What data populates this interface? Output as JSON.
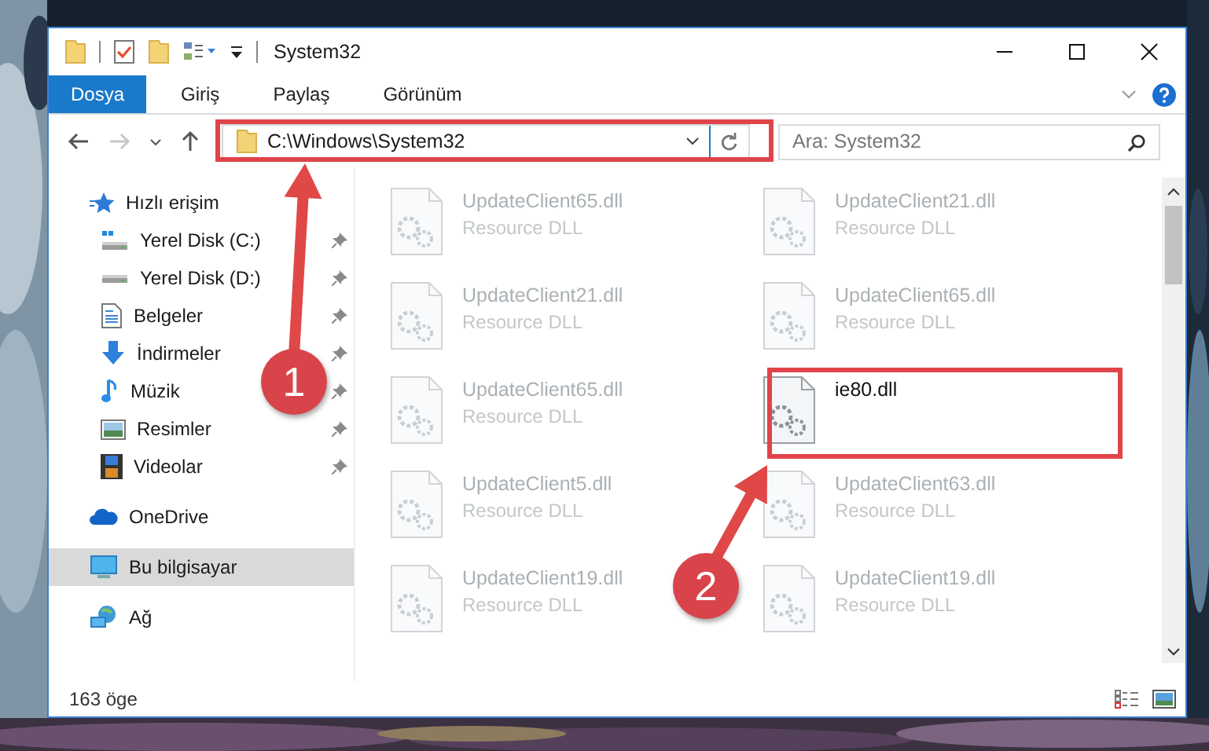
{
  "window": {
    "title": "System32"
  },
  "ribbon_tabs": [
    {
      "label": "Dosya",
      "selected": true
    },
    {
      "label": "Giriş",
      "selected": false
    },
    {
      "label": "Paylaş",
      "selected": false
    },
    {
      "label": "Görünüm",
      "selected": false
    }
  ],
  "address_bar": {
    "path": "C:\\Windows\\System32"
  },
  "search": {
    "placeholder": "Ara: System32"
  },
  "sidebar": {
    "items": [
      {
        "label": "Hızlı erişim",
        "kind": "star",
        "selected": false,
        "children": [
          {
            "label": "Yerel Disk (C:)",
            "kind": "windrive",
            "pinned": true,
            "selected": false
          },
          {
            "label": "Yerel Disk (D:)",
            "kind": "drive",
            "pinned": true,
            "selected": false
          },
          {
            "label": "Belgeler",
            "kind": "documents",
            "pinned": true,
            "selected": false
          },
          {
            "label": "İndirmeler",
            "kind": "download",
            "pinned": true,
            "selected": false
          },
          {
            "label": "Müzik",
            "kind": "music",
            "pinned": true,
            "selected": false
          },
          {
            "label": "Resimler",
            "kind": "pictures",
            "pinned": true,
            "selected": false
          },
          {
            "label": "Videolar",
            "kind": "videos",
            "pinned": true,
            "selected": false
          }
        ]
      },
      {
        "label": "OneDrive",
        "kind": "cloud",
        "selected": false
      },
      {
        "label": "Bu bilgisayar",
        "kind": "computer",
        "selected": true
      },
      {
        "label": "Ağ",
        "kind": "network",
        "selected": false
      }
    ]
  },
  "files": [
    {
      "name": "UpdateClient65.dll",
      "type": "Resource DLL",
      "blurred": true
    },
    {
      "name": "UpdateClient21.dll",
      "type": "Resource DLL",
      "blurred": true
    },
    {
      "name": "UpdateClient21.dll",
      "type": "Resource DLL",
      "blurred": true
    },
    {
      "name": "UpdateClient65.dll",
      "type": "Resource DLL",
      "blurred": true
    },
    {
      "name": "UpdateClient65.dll",
      "type": "Resource DLL",
      "blurred": true
    },
    {
      "name": "ie80.dll",
      "blurred": false
    },
    {
      "name": "UpdateClient5.dll",
      "type": "Resource DLL",
      "blurred": true
    },
    {
      "name": "UpdateClient63.dll",
      "type": "Resource DLL",
      "blurred": true
    },
    {
      "name": "UpdateClient19.dll",
      "type": "Resource DLL",
      "blurred": true
    },
    {
      "name": "UpdateClient19.dll",
      "type": "Resource DLL",
      "blurred": true
    }
  ],
  "status_bar": {
    "item_count": "163 öge"
  },
  "annotations": [
    {
      "label": "1"
    },
    {
      "label": "2"
    }
  ]
}
